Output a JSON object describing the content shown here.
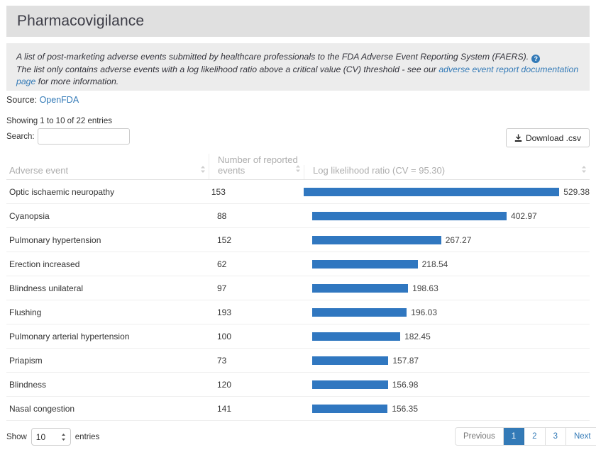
{
  "header": {
    "title": "Pharmacovigilance"
  },
  "info": {
    "line1_a": "A list of post-marketing adverse events submitted by healthcare professionals to the FDA Adverse Event Reporting System (FAERS).",
    "help_icon": "question-mark-icon",
    "line2_a": "The list only contains adverse events with a log likelihood ratio above a critical value (CV) threshold - see our ",
    "line2_link": "adverse event report documentation page",
    "line2_b": " for more information."
  },
  "source": {
    "label": "Source:",
    "link": "OpenFDA"
  },
  "table_controls": {
    "showing": "Showing 1 to 10 of 22 entries",
    "search_label": "Search:",
    "search_value": "",
    "search_placeholder": "",
    "download_label": "Download .csv",
    "download_icon": "download-icon"
  },
  "columns": [
    {
      "label": "Adverse event",
      "sort_icon": "sort-updown-icon"
    },
    {
      "label": "Number of reported events",
      "sort_icon": "sort-updown-icon"
    },
    {
      "label": "Log likelihood ratio (CV = 95.30)",
      "sort_icon": "sort-updown-icon"
    }
  ],
  "chart_data": {
    "type": "bar",
    "title": "Log likelihood ratio (CV = 95.30)",
    "xlabel": "Log likelihood ratio",
    "ylabel": "Adverse event",
    "orientation": "horizontal",
    "xlim": [
      0,
      529.38
    ],
    "grid": false,
    "legend": "none",
    "bar_color": "#3077c0",
    "categories": [
      "Optic ischaemic neuropathy",
      "Cyanopsia",
      "Pulmonary hypertension",
      "Erection increased",
      "Blindness unilateral",
      "Flushing",
      "Pulmonary arterial hypertension",
      "Priapism",
      "Blindness",
      "Nasal congestion"
    ],
    "values": [
      529.38,
      402.97,
      267.27,
      218.54,
      198.63,
      196.03,
      182.45,
      157.87,
      156.98,
      156.35
    ],
    "series": [
      {
        "name": "Number of reported events",
        "values": [
          153,
          88,
          152,
          62,
          97,
          193,
          100,
          73,
          120,
          141
        ]
      },
      {
        "name": "Log likelihood ratio",
        "values": [
          529.38,
          402.97,
          267.27,
          218.54,
          198.63,
          196.03,
          182.45,
          157.87,
          156.98,
          156.35
        ]
      }
    ],
    "critical_value": 95.3
  },
  "rows": [
    {
      "event": "Optic ischaemic neuropathy",
      "count": "153",
      "llr": "529.38",
      "llr_num": 529.38
    },
    {
      "event": "Cyanopsia",
      "count": "88",
      "llr": "402.97",
      "llr_num": 402.97
    },
    {
      "event": "Pulmonary hypertension",
      "count": "152",
      "llr": "267.27",
      "llr_num": 267.27
    },
    {
      "event": "Erection increased",
      "count": "62",
      "llr": "218.54",
      "llr_num": 218.54
    },
    {
      "event": "Blindness unilateral",
      "count": "97",
      "llr": "198.63",
      "llr_num": 198.63
    },
    {
      "event": "Flushing",
      "count": "193",
      "llr": "196.03",
      "llr_num": 196.03
    },
    {
      "event": "Pulmonary arterial hypertension",
      "count": "100",
      "llr": "182.45",
      "llr_num": 182.45
    },
    {
      "event": "Priapism",
      "count": "73",
      "llr": "157.87",
      "llr_num": 157.87
    },
    {
      "event": "Blindness",
      "count": "120",
      "llr": "156.98",
      "llr_num": 156.98
    },
    {
      "event": "Nasal congestion",
      "count": "141",
      "llr": "156.35",
      "llr_num": 156.35
    }
  ],
  "footer": {
    "show_label": "Show",
    "page_length": "10",
    "entries_label": "entries",
    "pagination": [
      {
        "label": "Previous",
        "state": "disabled"
      },
      {
        "label": "1",
        "state": "active"
      },
      {
        "label": "2",
        "state": "normal"
      },
      {
        "label": "3",
        "state": "normal"
      },
      {
        "label": "Next",
        "state": "normal"
      }
    ]
  },
  "colors": {
    "bar": "#3077c0",
    "link": "#337ab7",
    "banner": "#e0e0e0",
    "info_bg": "#ececec",
    "active_page": "#337ab7"
  }
}
